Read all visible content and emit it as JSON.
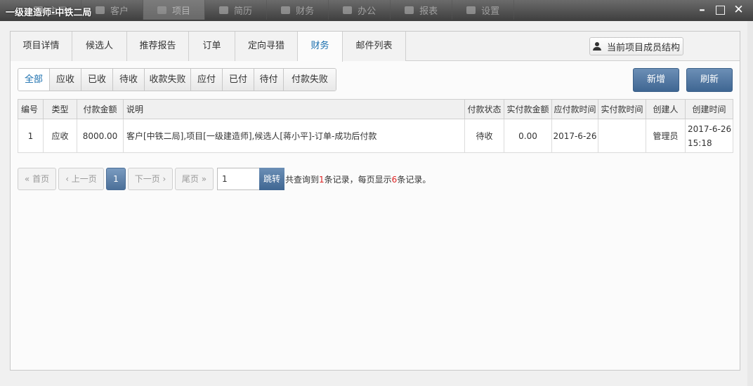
{
  "window": {
    "title": "一级建造师-中铁二局"
  },
  "topnav": [
    {
      "label": "主页",
      "icon": "home-icon"
    },
    {
      "label": "客户",
      "icon": "grid-icon"
    },
    {
      "label": "项目",
      "icon": "folder-icon",
      "active": true
    },
    {
      "label": "简历",
      "icon": "users-icon"
    },
    {
      "label": "财务",
      "icon": "table-icon"
    },
    {
      "label": "办公",
      "icon": "printer-icon"
    },
    {
      "label": "报表",
      "icon": "pie-chart-icon"
    },
    {
      "label": "设置",
      "icon": "chat-icon"
    }
  ],
  "tabs": [
    {
      "label": "项目详情"
    },
    {
      "label": "候选人"
    },
    {
      "label": "推荐报告"
    },
    {
      "label": "订单"
    },
    {
      "label": "定向寻猎"
    },
    {
      "label": "财务",
      "active": true
    },
    {
      "label": "邮件列表"
    }
  ],
  "member_button": {
    "label": "当前项目成员结构",
    "icon": "users-icon"
  },
  "filters": [
    {
      "label": "全部",
      "active": true
    },
    {
      "label": "应收"
    },
    {
      "label": "已收"
    },
    {
      "label": "待收"
    },
    {
      "label": "收款失败"
    },
    {
      "label": "应付"
    },
    {
      "label": "已付"
    },
    {
      "label": "待付"
    },
    {
      "label": "付款失败"
    }
  ],
  "actions": {
    "add": "新增",
    "refresh": "刷新"
  },
  "table": {
    "headers": [
      "编号",
      "类型",
      "付款金额",
      "说明",
      "付款状态",
      "实付款金额",
      "应付款时间",
      "实付款时间",
      "创建人",
      "创建时间"
    ],
    "rows": [
      {
        "id": "1",
        "type": "应收",
        "amount": "8000.00",
        "desc": "客户[中铁二局],项目[一级建造师],候选人[蒋小平]-订单-成功后付款",
        "status": "待收",
        "paid": "0.00",
        "due": "2017-6-26",
        "paid_time": "",
        "creator": "管理员",
        "created_date": "2017-6-26",
        "created_time": "15:18"
      }
    ]
  },
  "pager": {
    "first": "« 首页",
    "prev": "‹ 上一页",
    "current": "1",
    "next": "下一页 ›",
    "last": "尾页 »",
    "jump_value": "1",
    "jump": "跳转",
    "info_prefix": "共查询到",
    "total": "1",
    "info_mid": "条记录，每页显示",
    "per_page": "6",
    "info_suffix": "条记录。"
  }
}
